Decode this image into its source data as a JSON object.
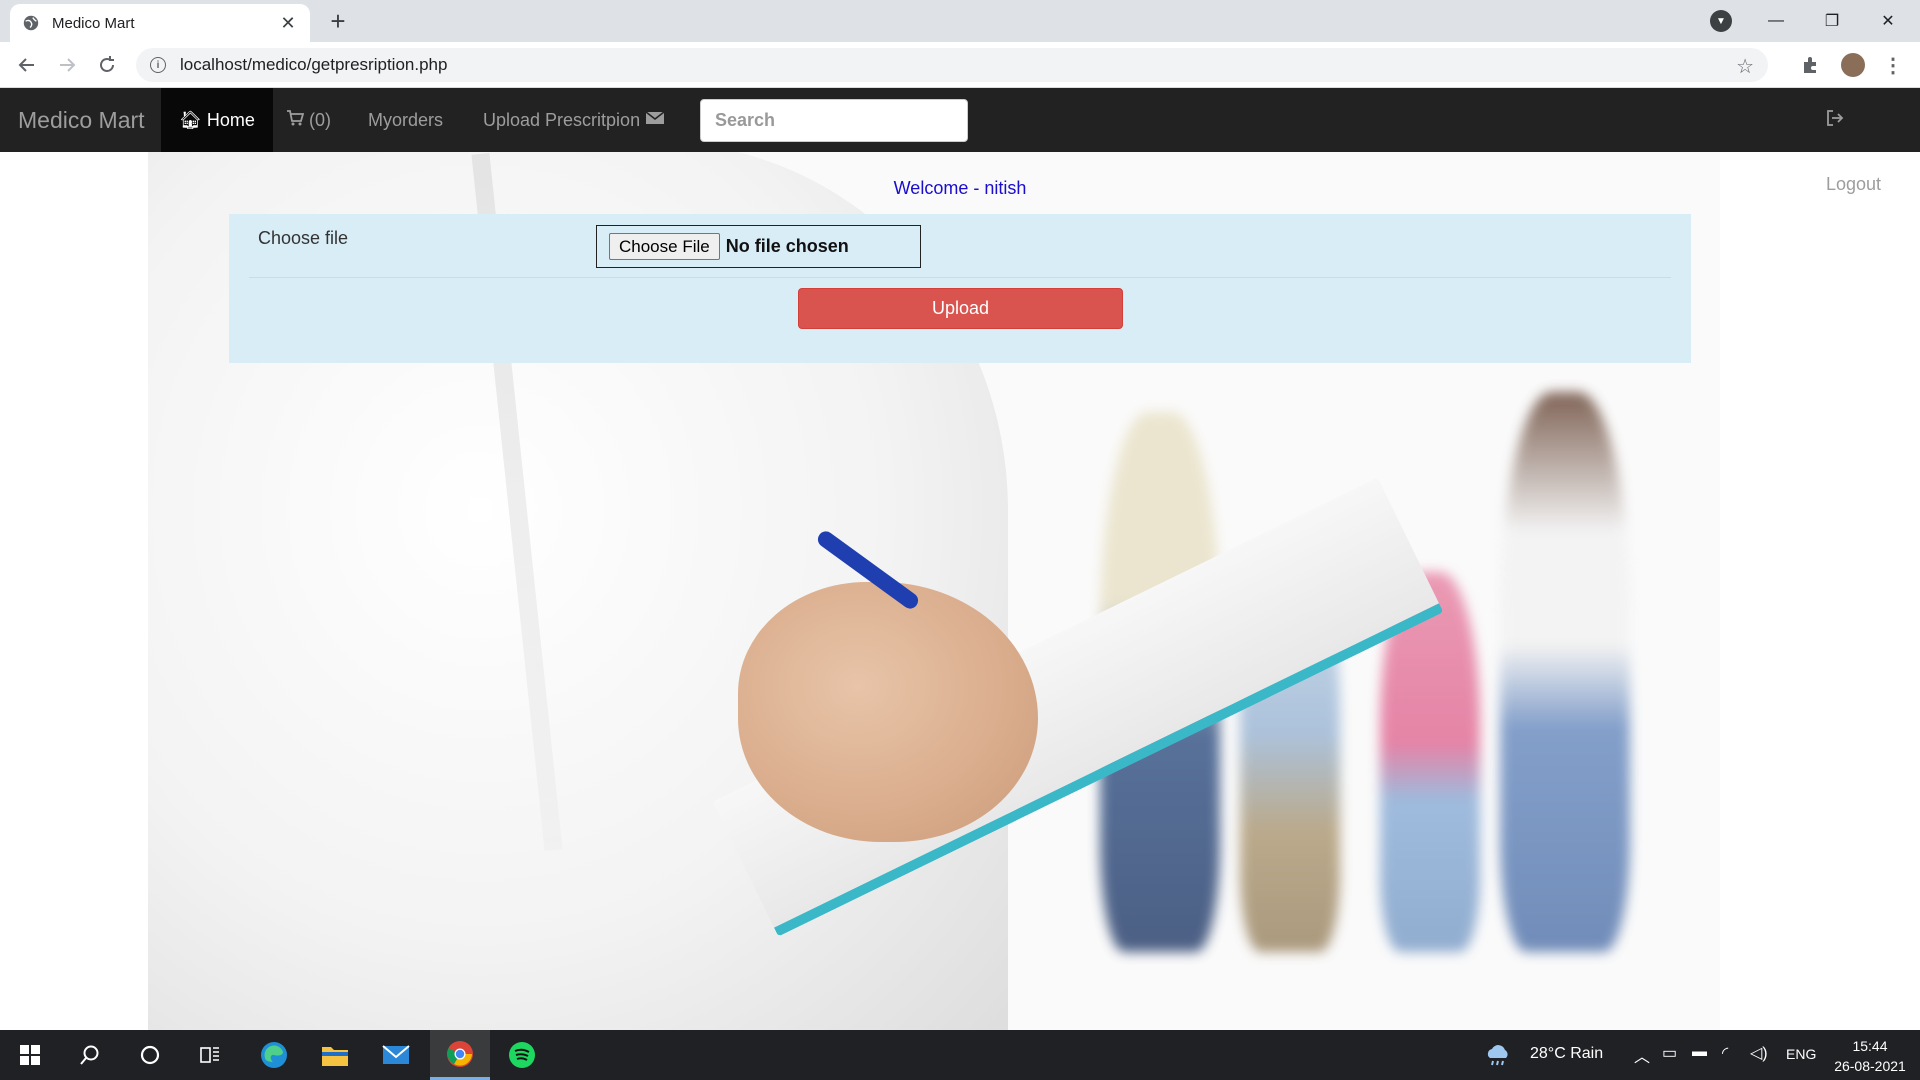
{
  "browser": {
    "tab_title": "Medico Mart",
    "url": "localhost/medico/getpresription.php"
  },
  "navbar": {
    "brand": "Medico Mart",
    "home": "Home",
    "cart": "(0)",
    "myorders": "Myorders",
    "upload": "Upload Prescritpion",
    "search_placeholder": "Search",
    "logout": "Logout"
  },
  "content": {
    "welcome": "Welcome - nitish",
    "file_label": "Choose file",
    "choose_button": "Choose File",
    "file_status": "No file chosen",
    "upload_button": "Upload"
  },
  "taskbar": {
    "weather": "28°C Rain",
    "language": "ENG",
    "time": "15:44",
    "date": "26-08-2021"
  }
}
